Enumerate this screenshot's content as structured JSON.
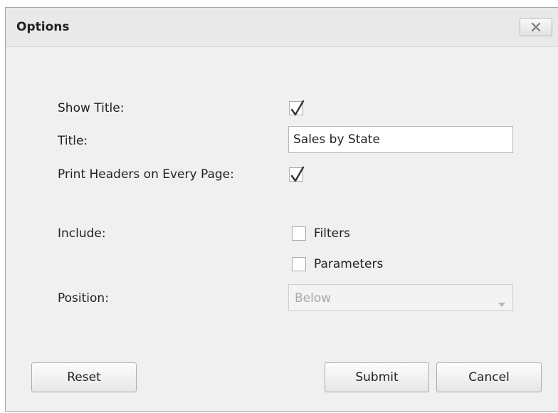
{
  "dialog": {
    "title": "Options",
    "close_icon": "close-icon"
  },
  "form": {
    "show_title": {
      "label": "Show Title:",
      "checked": true
    },
    "title": {
      "label": "Title:",
      "value": "Sales by State"
    },
    "print_headers": {
      "label": "Print Headers on Every Page:",
      "checked": true
    },
    "include": {
      "label": "Include:",
      "filters": {
        "label": "Filters",
        "checked": false
      },
      "parameters": {
        "label": "Parameters",
        "checked": false
      }
    },
    "position": {
      "label": "Position:",
      "value": "Below",
      "disabled": true
    }
  },
  "buttons": {
    "reset": "Reset",
    "submit": "Submit",
    "cancel": "Cancel"
  }
}
